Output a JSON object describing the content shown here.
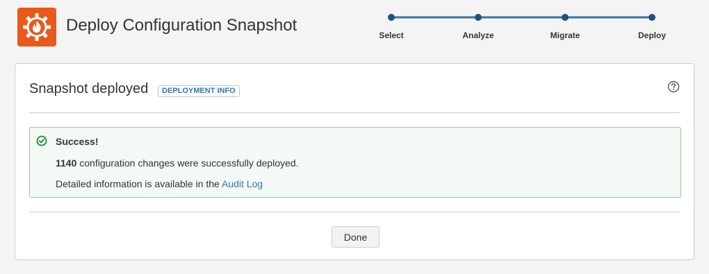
{
  "header": {
    "title": "Deploy Configuration Snapshot",
    "logo_icon": "gear-flame-icon",
    "logo_color": "#e8591a"
  },
  "stepper": {
    "steps": [
      {
        "label": "Select",
        "state": "complete"
      },
      {
        "label": "Analyze",
        "state": "complete"
      },
      {
        "label": "Migrate",
        "state": "complete"
      },
      {
        "label": "Deploy",
        "state": "current"
      }
    ],
    "progress": 1.0,
    "accent_color": "#3572b0"
  },
  "panel": {
    "title": "Snapshot deployed",
    "badge_label": "DEPLOYMENT INFO",
    "help_icon": "question-circle-icon"
  },
  "alert": {
    "type": "success",
    "icon": "check-circle-icon",
    "title": "Success!",
    "count": "1140",
    "message": "configuration changes were successfully deployed.",
    "detail_text": "Detailed information is available in the",
    "link_label": "Audit Log",
    "border_color": "#91c89c",
    "background_color": "#f3f9f4"
  },
  "footer": {
    "done_label": "Done"
  }
}
